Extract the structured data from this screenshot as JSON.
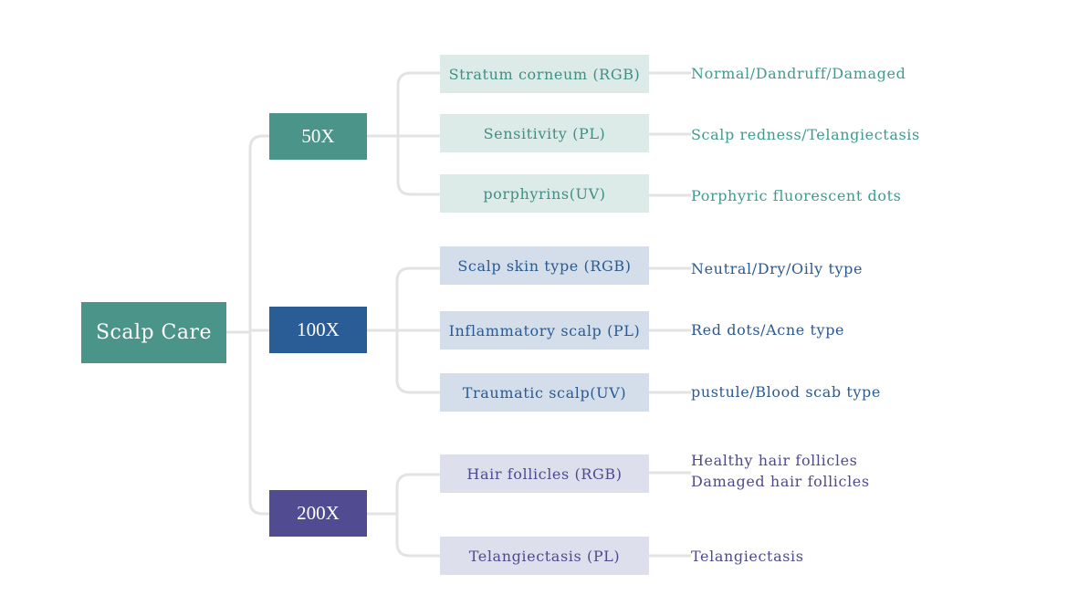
{
  "root": {
    "label": "Scalp Care",
    "color": "#4a948a"
  },
  "branches": [
    {
      "label": "50X",
      "color": "#4a948a",
      "children": [
        {
          "label": "Stratum corneum (RGB)",
          "result": [
            "Normal/Dandruff/Damaged"
          ]
        },
        {
          "label": "Sensitivity (PL)",
          "result": [
            "Scalp redness/Telangiectasis"
          ]
        },
        {
          "label": "porphyrins(UV)",
          "result": [
            "Porphyric fluorescent dots"
          ]
        }
      ]
    },
    {
      "label": "100X",
      "color": "#2a5c96",
      "children": [
        {
          "label": "Scalp skin type (RGB)",
          "result": [
            "Neutral/Dry/Oily type"
          ]
        },
        {
          "label": "Inflammatory scalp (PL)",
          "result": [
            "Red dots/Acne type"
          ]
        },
        {
          "label": "Traumatic scalp(UV)",
          "result": [
            "pustule/Blood scab type"
          ]
        }
      ]
    },
    {
      "label": "200X",
      "color": "#514b91",
      "children": [
        {
          "label": "Hair follicles (RGB)",
          "result": [
            "Healthy hair follicles",
            "Damaged hair follicles"
          ]
        },
        {
          "label": "Telangiectasis (PL)",
          "result": [
            "Telangiectasis"
          ]
        }
      ]
    }
  ]
}
